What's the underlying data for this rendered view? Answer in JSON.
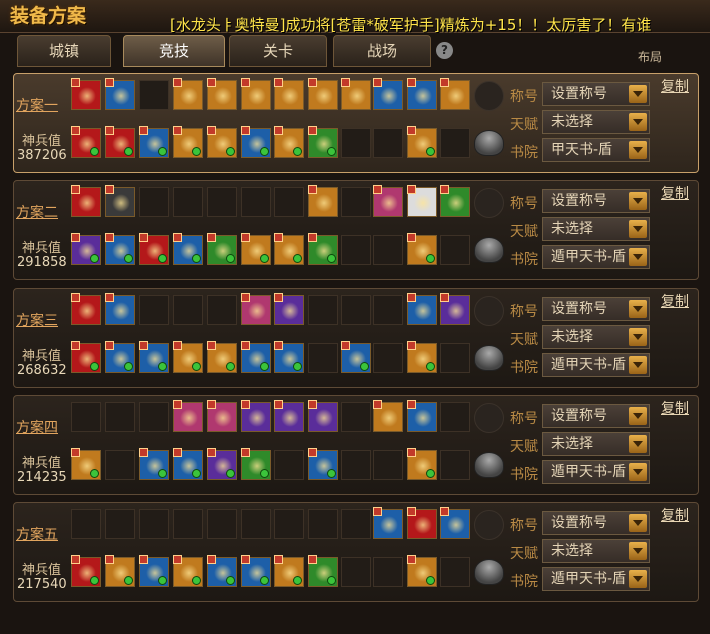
{
  "title": "装备方案",
  "ticker": "[水龙头ㅑ奥特曼]成功将[苍雷*破军护手]精炼为+15！！太厉害了！有谁",
  "corner_label": "布局",
  "tabs": [
    {
      "label": "城镇",
      "active": false
    },
    {
      "label": "竞技",
      "active": true
    },
    {
      "label": "关卡",
      "active": false
    },
    {
      "label": "战场",
      "active": false
    }
  ],
  "help_icon": "?",
  "labels": {
    "title_field": "称号",
    "talent": "天赋",
    "academy": "书院",
    "power": "神兵值",
    "copy": "复制"
  },
  "plans": [
    {
      "name": "方案一",
      "power": "387206",
      "active": true,
      "title_value": "设置称号",
      "talent_value": "未选择",
      "academy_value": "甲天书-盾",
      "row1": [
        "red",
        "blue",
        "empty",
        "gold",
        "gold",
        "gold",
        "gold",
        "gold",
        "gold",
        "blue",
        "blue",
        "gold",
        "empty"
      ],
      "row2": [
        "red",
        "red",
        "blue",
        "gold",
        "gold",
        "blue",
        "gold",
        "green",
        "empty",
        "empty",
        "gold",
        "empty"
      ]
    },
    {
      "name": "方案二",
      "power": "291858",
      "active": false,
      "title_value": "设置称号",
      "talent_value": "未选择",
      "academy_value": "遁甲天书-盾",
      "row1": [
        "red",
        "dark",
        "empty",
        "empty",
        "empty",
        "empty",
        "empty",
        "gold",
        "empty",
        "pink",
        "panda",
        "green",
        "empty"
      ],
      "row2": [
        "purple",
        "blue",
        "red",
        "blue",
        "green",
        "gold",
        "gold",
        "green",
        "empty",
        "empty",
        "gold",
        "empty"
      ]
    },
    {
      "name": "方案三",
      "power": "268632",
      "active": false,
      "title_value": "设置称号",
      "talent_value": "未选择",
      "academy_value": "遁甲天书-盾",
      "row1": [
        "red",
        "blue",
        "empty",
        "empty",
        "empty",
        "pink",
        "purple",
        "empty",
        "empty",
        "empty",
        "blue",
        "purple",
        "empty"
      ],
      "row2": [
        "red",
        "blue",
        "blue",
        "gold",
        "gold",
        "blue",
        "blue",
        "empty",
        "blue",
        "empty",
        "gold",
        "empty"
      ]
    },
    {
      "name": "方案四",
      "power": "214235",
      "active": false,
      "title_value": "设置称号",
      "talent_value": "未选择",
      "academy_value": "遁甲天书-盾",
      "row1": [
        "empty",
        "empty",
        "empty",
        "pink",
        "pink",
        "purple",
        "purple",
        "purple",
        "empty",
        "gold",
        "blue",
        "empty",
        "empty"
      ],
      "row2": [
        "gold",
        "empty",
        "blue",
        "blue",
        "purple",
        "green",
        "empty",
        "blue",
        "empty",
        "empty",
        "gold",
        "empty"
      ]
    },
    {
      "name": "方案五",
      "power": "217540",
      "active": false,
      "title_value": "设置称号",
      "talent_value": "未选择",
      "academy_value": "遁甲天书-盾",
      "row1": [
        "empty",
        "empty",
        "empty",
        "empty",
        "empty",
        "empty",
        "empty",
        "empty",
        "empty",
        "blue",
        "red",
        "blue",
        "empty"
      ],
      "row2": [
        "red",
        "gold",
        "blue",
        "gold",
        "blue",
        "blue",
        "gold",
        "green",
        "empty",
        "empty",
        "gold",
        "empty"
      ]
    }
  ],
  "colors": {
    "red": "#b4181a",
    "blue": "#1d5fa8",
    "gold": "#c07a1e",
    "green": "#2f8a2a",
    "purple": "#5a2d9a",
    "pink": "#b0386f",
    "dark": "#3a3a3a",
    "panda": "#dcdcdc",
    "empty": "#221c17"
  }
}
